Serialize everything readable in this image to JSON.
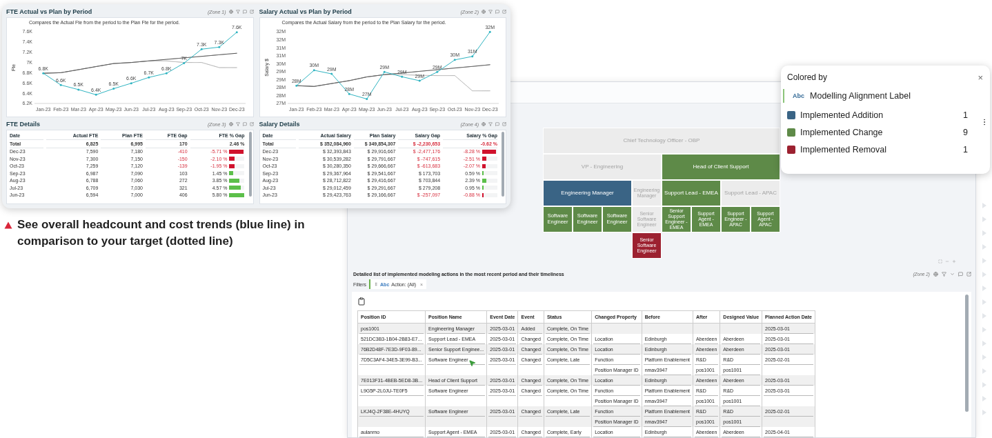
{
  "dashboard_card": {
    "panels": [
      {
        "kind": "chart",
        "title": "FTE Actual vs Plan by Period",
        "zone": "(Zone 1)",
        "subtitle": "Compares the Actual Fte from the period to the Plan Fte for the period.",
        "chart_data": {
          "type": "line",
          "ylabel": "Fte",
          "categories": [
            "Jan-23",
            "Feb-23",
            "Mar-23",
            "Apr-23",
            "May-23",
            "Jun-23",
            "Jul-23",
            "Aug-23",
            "Sep-23",
            "Oct-23",
            "Nov-23",
            "Dec-23"
          ],
          "ylim": [
            6.2,
            7.6
          ],
          "yticks": [
            {
              "value": 6.2,
              "label": "6.2K"
            },
            {
              "value": 6.4,
              "label": "6.4K"
            },
            {
              "value": 6.6,
              "label": "6.6K"
            },
            {
              "value": 6.8,
              "label": "6.8K"
            },
            {
              "value": 7,
              "label": "7K"
            },
            {
              "value": 7.2,
              "label": "7.2K"
            },
            {
              "value": 7.4,
              "label": "7.4K"
            },
            {
              "value": 7.6,
              "label": "7.6K"
            }
          ],
          "series": [
            {
              "line_style": "dotted",
              "color": "#b8b8b8",
              "values": [
                6.79,
                6.8,
                6.86,
                6.92,
                6.98,
                7.0,
                7.03,
                7.03,
                7.0,
                7.0,
                6.9,
                6.9
              ]
            },
            {
              "line_style": "dotted",
              "color": "#555555",
              "values": [
                6.79,
                6.8,
                6.86,
                6.92,
                6.98,
                7.0,
                7.03,
                7.06,
                7.09,
                7.12,
                7.15,
                7.18
              ]
            },
            {
              "line_style": "solid",
              "color": "#2fb4c1",
              "values": [
                6.79,
                6.56,
                6.47,
                6.37,
                6.49,
                6.594,
                6.709,
                6.788,
                6.987,
                7.259,
                7.3,
                7.59
              ],
              "value_labels": [
                "6.8K",
                "6.6K",
                "6.5K",
                "6.4K",
                "6.5K",
                "6.6K",
                "6.7K",
                "6.8K",
                "7K",
                "7.3K",
                "7.3K",
                "7.6K"
              ]
            }
          ]
        }
      },
      {
        "kind": "chart",
        "title": "Salary Actual vs Plan by Period",
        "zone": "(Zone 2)",
        "subtitle": "Compares the Actual Salary from the period to the Plan Salary for the period.",
        "chart_data": {
          "type": "line",
          "ylabel": "Salary $",
          "categories": [
            "Jan-23",
            "Feb-23",
            "Mar-23",
            "Apr-23",
            "May-23",
            "Jun-23",
            "Jul-23",
            "Aug-23",
            "Sep-23",
            "Oct-23",
            "Nov-23",
            "Dec-23"
          ],
          "ylim": [
            27,
            32.4
          ],
          "yticks": [
            {
              "value": 27,
              "label": "27M"
            },
            {
              "value": 27.6,
              "label": "28M"
            },
            {
              "value": 28.2,
              "label": "28M"
            },
            {
              "value": 28.8,
              "label": "29M"
            },
            {
              "value": 29.4,
              "label": "29M"
            },
            {
              "value": 30,
              "label": "30M"
            },
            {
              "value": 30.6,
              "label": "31M"
            },
            {
              "value": 31.2,
              "label": "31M"
            },
            {
              "value": 31.8,
              "label": "32M"
            },
            {
              "value": 32.4,
              "label": "32M"
            }
          ],
          "series": [
            {
              "line_style": "dotted",
              "color": "#b8b8b8",
              "values": [
                28.34,
                28.28,
                28.5,
                28.72,
                29.0,
                29.17,
                29.17,
                29.12,
                29.1,
                29.1,
                27.95,
                27.95
              ]
            },
            {
              "line_style": "dotted",
              "color": "#555555",
              "values": [
                28.34,
                28.28,
                28.5,
                28.72,
                29.0,
                29.17,
                29.29,
                29.42,
                29.54,
                29.67,
                29.79,
                29.92
              ]
            },
            {
              "line_style": "solid",
              "color": "#2fb4c1",
              "values": [
                28.34,
                29.5,
                29.23,
                27.71,
                27.34,
                29.38,
                29.01,
                28.71,
                29.37,
                30.28,
                30.54,
                32.39
              ],
              "value_labels": [
                "28M",
                "30M",
                "29M",
                "28M",
                "27M",
                "29M",
                "29M",
                "29M",
                "29M",
                "30M",
                "31M",
                "32M"
              ]
            }
          ]
        }
      },
      {
        "kind": "table",
        "title": "FTE Details",
        "zone": "(Zone 3)",
        "columns": [
          "Date",
          "Actual FTE",
          "Plan FTE",
          "FTE Gap",
          "FTE % Gap"
        ],
        "total": {
          "date": "Total",
          "actual": "6,825",
          "plan": "6,995",
          "gap": "170",
          "pct": "2.46 %",
          "negative": false
        },
        "rows": [
          {
            "date": "Dec-23",
            "actual": "7,590",
            "plan": "7,180",
            "gap": "-410",
            "pct": "-5.71 %",
            "negative": true,
            "level": 0.95
          },
          {
            "date": "Nov-23",
            "actual": "7,300",
            "plan": "7,150",
            "gap": "-150",
            "pct": "-2.10 %",
            "negative": true,
            "level": 0.35
          },
          {
            "date": "Oct-23",
            "actual": "7,259",
            "plan": "7,120",
            "gap": "-139",
            "pct": "-1.95 %",
            "negative": true,
            "level": 0.33
          },
          {
            "date": "Sep-23",
            "actual": "6,987",
            "plan": "7,090",
            "gap": "103",
            "pct": "1.45 %",
            "negative": false,
            "level": 0.24
          },
          {
            "date": "Aug-23",
            "actual": "6,788",
            "plan": "7,060",
            "gap": "272",
            "pct": "3.85 %",
            "negative": false,
            "level": 0.64
          },
          {
            "date": "Jul-23",
            "actual": "6,709",
            "plan": "7,030",
            "gap": "321",
            "pct": "4.57 %",
            "negative": false,
            "level": 0.76
          },
          {
            "date": "Jun-23",
            "actual": "6,594",
            "plan": "7,000",
            "gap": "406",
            "pct": "5.80 %",
            "negative": false,
            "level": 0.97
          }
        ]
      },
      {
        "kind": "table",
        "title": "Salary Details",
        "zone": "(Zone 4)",
        "columns": [
          "Date",
          "Actual Salary",
          "Plan Salary",
          "Salary Gap",
          "Salary % Gap"
        ],
        "total": {
          "date": "Total",
          "actual": "$ 352,084,960",
          "plan": "$ 349,854,307",
          "gap": "$ -2,230,653",
          "pct": "-0.62 %",
          "negative": true
        },
        "rows": [
          {
            "date": "Dec-23",
            "actual": "$ 32,393,843",
            "plan": "$ 29,916,667",
            "gap": "$ -2,477,176",
            "pct": "-8.28 %",
            "negative": true,
            "level": 0.92
          },
          {
            "date": "Nov-23",
            "actual": "$ 30,539,282",
            "plan": "$ 29,791,667",
            "gap": "$ -747,615",
            "pct": "-2.51 %",
            "negative": true,
            "level": 0.28
          },
          {
            "date": "Oct-23",
            "actual": "$ 30,280,350",
            "plan": "$ 29,666,667",
            "gap": "$ -613,683",
            "pct": "-2.07 %",
            "negative": true,
            "level": 0.23
          },
          {
            "date": "Sep-23",
            "actual": "$ 29,367,964",
            "plan": "$ 29,541,667",
            "gap": "$ 173,703",
            "pct": "0.59 %",
            "negative": false,
            "level": 0.07
          },
          {
            "date": "Aug-23",
            "actual": "$ 28,712,822",
            "plan": "$ 29,416,667",
            "gap": "$ 703,844",
            "pct": "2.39 %",
            "negative": false,
            "level": 0.27
          },
          {
            "date": "Jul-23",
            "actual": "$ 29,012,459",
            "plan": "$ 29,291,667",
            "gap": "$ 279,208",
            "pct": "0.95 %",
            "negative": false,
            "level": 0.11
          },
          {
            "date": "Jun-23",
            "actual": "$ 29,423,763",
            "plan": "$ 29,166,667",
            "gap": "$ -257,097",
            "pct": "-0.88 %",
            "negative": true,
            "level": 0.1
          }
        ]
      }
    ]
  },
  "caption": "See overall headcount and cost trends (blue line) in comparison to your target (dotted line)",
  "treemap": {
    "cells": [
      {
        "label": "Chief Technology Officer - OBP",
        "color": "#ececec"
      },
      {
        "label": "VP - Engineering",
        "color": "#ececec"
      },
      {
        "label": "Head of Client Support",
        "color": "#5e8a48"
      },
      {
        "label": "Engineering Manager",
        "color": "#3a6485"
      },
      {
        "label": "Engineering Manager",
        "color": "#ececec"
      },
      {
        "label": "Support Lead - EMEA",
        "color": "#5e8a48"
      },
      {
        "label": "Support Lead - APAC",
        "color": "#ececec"
      },
      {
        "label": "Software Engineer",
        "color": "#5e8a48"
      },
      {
        "label": "Software Engineer",
        "color": "#5e8a48"
      },
      {
        "label": "Software Engineer",
        "color": "#5e8a48"
      },
      {
        "label": "Senior Software Engineer",
        "color": "#ececec"
      },
      {
        "label": "Senior Support Engineer - EMEA",
        "color": "#5e8a48"
      },
      {
        "label": "Support Agent - EMEA",
        "color": "#5e8a48"
      },
      {
        "label": "Support Engineer - APAC",
        "color": "#5e8a48"
      },
      {
        "label": "Support Agent - APAC",
        "color": "#5e8a48"
      },
      {
        "label": "Senior Software Engineer",
        "color": "#9c2130"
      }
    ]
  },
  "legend": {
    "title": "Colored by",
    "close": "×",
    "field_tag": "Abc",
    "field": "Modelling Alignment Label",
    "items": [
      {
        "label": "Implemented Addition",
        "count": "1",
        "color": "#3a6485"
      },
      {
        "label": "Implemented Change",
        "count": "9",
        "color": "#5e8a48"
      },
      {
        "label": "Implemented Removal",
        "count": "1",
        "color": "#9c2130"
      }
    ]
  },
  "actions_table": {
    "title": "Detailed list of implemented modeling actions in the most recent period and their timeliness",
    "zone": "(Zone 2)",
    "filters_label": "Filters",
    "filter": {
      "type_tag": "Abc",
      "label": "Action: (All)",
      "remove": "×"
    },
    "columns": [
      "Position ID",
      "Position Name",
      "Event Date",
      "Event",
      "Status",
      "Changed Property",
      "Before",
      "After",
      "Designed Value",
      "Planned Action Date"
    ],
    "rows": [
      {
        "position_id": "pos1001",
        "position_name": "Engineering Manager",
        "event_date": "2025-03-01",
        "event": "Added",
        "status": "Complete, On Time",
        "planned_action_date": "2025-03-01"
      },
      {
        "position_id": "521DC3B3-1B04-2B83-E7...",
        "position_name": "Support Lead - EMEA",
        "event_date": "2025-03-01",
        "event": "Changed",
        "status": "Complete, On Time",
        "changed_property": [
          "Location"
        ],
        "before": [
          "Edinburgh"
        ],
        "after": [
          "Aberdeen"
        ],
        "designed_value": [
          "Aberdeen"
        ],
        "planned_action_date": "2025-03-01"
      },
      {
        "position_id": "76B2D48F-7E3D-9F03-89...",
        "position_name": "Senior Support Enginee...",
        "event_date": "2025-03-01",
        "event": "Changed",
        "status": "Complete, On Time",
        "changed_property": [
          "Location"
        ],
        "before": [
          "Edinburgh"
        ],
        "after": [
          "Aberdeen"
        ],
        "designed_value": [
          "Aberdeen"
        ],
        "planned_action_date": "2025-03-01"
      },
      {
        "position_id": "7D5C3AF4-34E5-3E99-B3...",
        "position_name": "Software Engineer",
        "event_date": "2025-03-01",
        "event": "Changed",
        "status": "Complete, Late",
        "changed_property": [
          "Function",
          "Position Manager ID"
        ],
        "before": [
          "Platform Enablement",
          "nmav3947"
        ],
        "after": [
          "R&D",
          "pos1001"
        ],
        "designed_value": [
          "R&D",
          "pos1001"
        ],
        "planned_action_date": "2025-02-01"
      },
      {
        "position_id": "7E013F31-4BEB-5ED8-3B...",
        "position_name": "Head of Client Support",
        "event_date": "2025-03-01",
        "event": "Changed",
        "status": "Complete, On Time",
        "changed_property": [
          "Location"
        ],
        "before": [
          "Edinburgh"
        ],
        "after": [
          "Aberdeen"
        ],
        "designed_value": [
          "Aberdeen"
        ],
        "planned_action_date": "2025-03-01"
      },
      {
        "position_id": "L9G5P-2L0JU-TE0F5",
        "position_name": "Software Engineer",
        "event_date": "2025-03-01",
        "event": "Changed",
        "status": "Complete, On Time",
        "changed_property": [
          "Function",
          "Position Manager ID"
        ],
        "before": [
          "Platform Enablement",
          "nmav3947"
        ],
        "after": [
          "R&D",
          "pos1001"
        ],
        "designed_value": [
          "R&D",
          "pos1001"
        ],
        "planned_action_date": "2025-03-01"
      },
      {
        "position_id": "LKJ4Q-2F38E-4HUYQ",
        "position_name": "Software Engineer",
        "event_date": "2025-03-01",
        "event": "Changed",
        "status": "Complete, Late",
        "changed_property": [
          "Function",
          "Position Manager ID"
        ],
        "before": [
          "Platform Enablement",
          "nmav3947"
        ],
        "after": [
          "R&D",
          "pos1001"
        ],
        "designed_value": [
          "R&D",
          "pos1001"
        ],
        "planned_action_date": "2025-02-01"
      },
      {
        "position_id": "aulanrno",
        "position_name": "Support Agent - EMEA",
        "event_date": "2025-03-01",
        "event": "Changed",
        "status": "Complete, Early",
        "changed_property": [
          "Location"
        ],
        "before": [
          "Edinburgh"
        ],
        "after": [
          "Aberdeen"
        ],
        "designed_value": [
          "Aberdeen"
        ],
        "planned_action_date": "2025-04-01"
      }
    ]
  }
}
